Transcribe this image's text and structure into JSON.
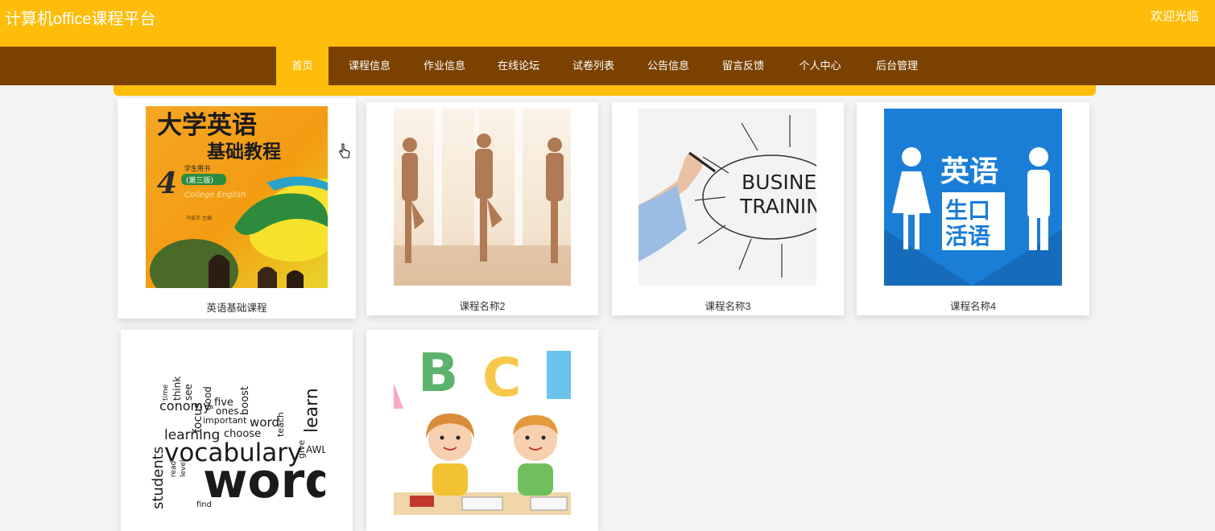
{
  "header": {
    "site_title": "计算机office课程平台",
    "welcome": "欢迎光临"
  },
  "nav": {
    "items": [
      {
        "label": "首页"
      },
      {
        "label": "课程信息"
      },
      {
        "label": "作业信息"
      },
      {
        "label": "在线论坛"
      },
      {
        "label": "试卷列表"
      },
      {
        "label": "公告信息"
      },
      {
        "label": "留言反馈"
      },
      {
        "label": "个人中心"
      },
      {
        "label": "后台管理"
      }
    ]
  },
  "courses": [
    {
      "name": "英语基础课程",
      "image": "textbook-cover-image",
      "cover_title_1": "大学英语",
      "cover_title_2": "基础教程",
      "cover_number": "4",
      "cover_label_student": "学生用书",
      "cover_edition": "(第三版)",
      "cover_english": "College English",
      "cover_editor": "马俊杰 主编"
    },
    {
      "name": "课程名称2",
      "image": "yoga-class-photo"
    },
    {
      "name": "课程名称3",
      "image": "business-training-image",
      "words_1": "BUSINES",
      "words_2": "TRAININ"
    },
    {
      "name": "课程名称4",
      "image": "english-spoken-language-image",
      "sign_1": "英语",
      "sign_2a": "生口",
      "sign_2b": "活语"
    },
    {
      "name": "",
      "image": "vocabulary-word-cloud-image",
      "big_1": "vocabulary",
      "big_2": "word",
      "w_learning": "learning",
      "w_focus": "focus",
      "w_important": "important",
      "w_choose": "choose",
      "w_economy": "conomy",
      "w_five": "five",
      "w_boost": "boost",
      "w_ones": "ones",
      "w_learn": "learn",
      "w_students": "students",
      "w_word": "word",
      "w_time": "time",
      "w_think": "think",
      "w_see": "see",
      "w_good": "good",
      "w_find": "find",
      "w_level": "level",
      "w_read": "read",
      "w_teach": "teach",
      "w_give": "give",
      "w_awl": "AWL"
    },
    {
      "name": "",
      "image": "abc-kids-cartoon-image",
      "letter_b": "B",
      "letter_c": "C"
    }
  ],
  "colors": {
    "accent": "#fdbd0a",
    "nav_bg": "#7a4100"
  }
}
